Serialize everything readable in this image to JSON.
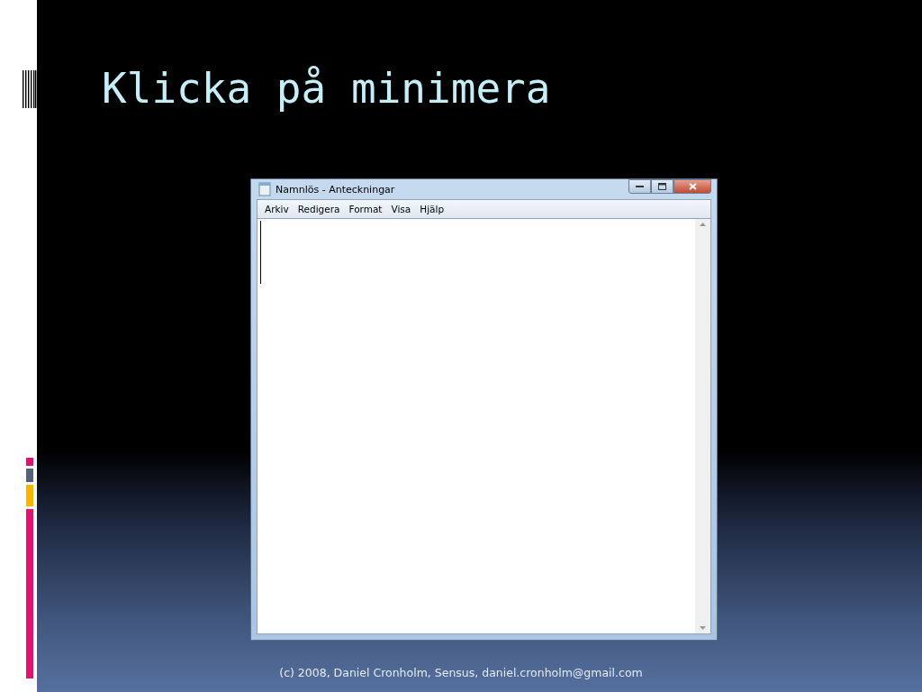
{
  "slide": {
    "title": "Klicka på minimera",
    "footer": "(c) 2008, Daniel Cronholm, Sensus, daniel.cronholm@gmail.com"
  },
  "window": {
    "title": "Namnlös - Anteckningar",
    "menu": [
      "Arkiv",
      "Redigera",
      "Format",
      "Visa",
      "Hjälp"
    ]
  }
}
